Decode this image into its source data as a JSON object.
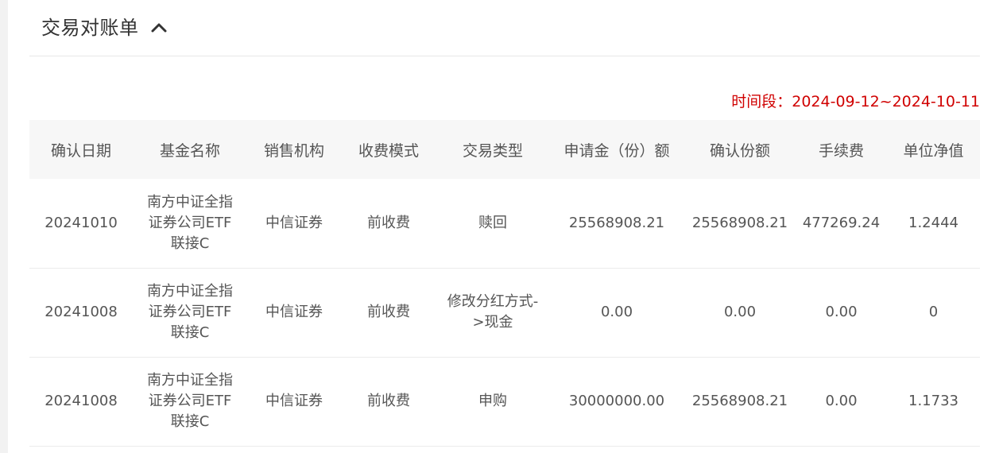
{
  "header": {
    "title": "交易对账单",
    "toggle_icon": "chevron-up-icon"
  },
  "period": {
    "text": "时间段：2024-09-12~2024-10-11"
  },
  "table": {
    "columns": [
      "确认日期",
      "基金名称",
      "销售机构",
      "收费模式",
      "交易类型",
      "申请金（份）额",
      "确认份额",
      "手续费",
      "单位净值"
    ],
    "rows": [
      {
        "date": "20241010",
        "fund_lines": [
          "南方中证全指",
          "证券公司ETF",
          "联接C"
        ],
        "agency": "中信证券",
        "fee_mode": "前收费",
        "type_lines": [
          "赎回"
        ],
        "apply_amount": "25568908.21",
        "confirmed_shares": "25568908.21",
        "fee": "477269.24",
        "nav": "1.2444"
      },
      {
        "date": "20241008",
        "fund_lines": [
          "南方中证全指",
          "证券公司ETF",
          "联接C"
        ],
        "agency": "中信证券",
        "fee_mode": "前收费",
        "type_lines": [
          "修改分红方式-",
          ">现金"
        ],
        "apply_amount": "0.00",
        "confirmed_shares": "0.00",
        "fee": "0.00",
        "nav": "0"
      },
      {
        "date": "20241008",
        "fund_lines": [
          "南方中证全指",
          "证券公司ETF",
          "联接C"
        ],
        "agency": "中信证券",
        "fee_mode": "前收费",
        "type_lines": [
          "申购"
        ],
        "apply_amount": "30000000.00",
        "confirmed_shares": "25568908.21",
        "fee": "0.00",
        "nav": "1.1733"
      }
    ]
  }
}
